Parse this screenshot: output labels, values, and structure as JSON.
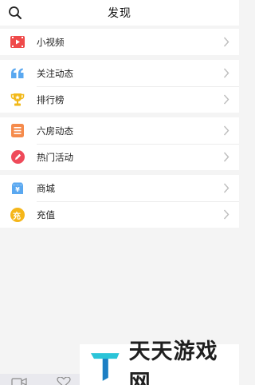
{
  "header": {
    "title": "发现"
  },
  "groups": [
    {
      "items": [
        {
          "label": "小视频",
          "icon": "video-icon",
          "color": "#ef4a4a"
        }
      ]
    },
    {
      "items": [
        {
          "label": "关注动态",
          "icon": "quote-icon",
          "color": "#5aa8f0"
        },
        {
          "label": "排行榜",
          "icon": "trophy-icon",
          "color": "#f2b91a"
        }
      ]
    },
    {
      "items": [
        {
          "label": "六房动态",
          "icon": "list-icon",
          "color": "#f58b4c"
        },
        {
          "label": "热门活动",
          "icon": "pen-icon",
          "color": "#ef4a5a"
        }
      ]
    },
    {
      "items": [
        {
          "label": "商城",
          "icon": "shop-icon",
          "color": "#5aa8f0"
        },
        {
          "label": "充值",
          "icon": "recharge-icon",
          "color": "#f5b61a"
        }
      ]
    }
  ],
  "shop_glyph": "¥",
  "recharge_glyph": "充",
  "watermark": {
    "text": "天天游戏网"
  }
}
